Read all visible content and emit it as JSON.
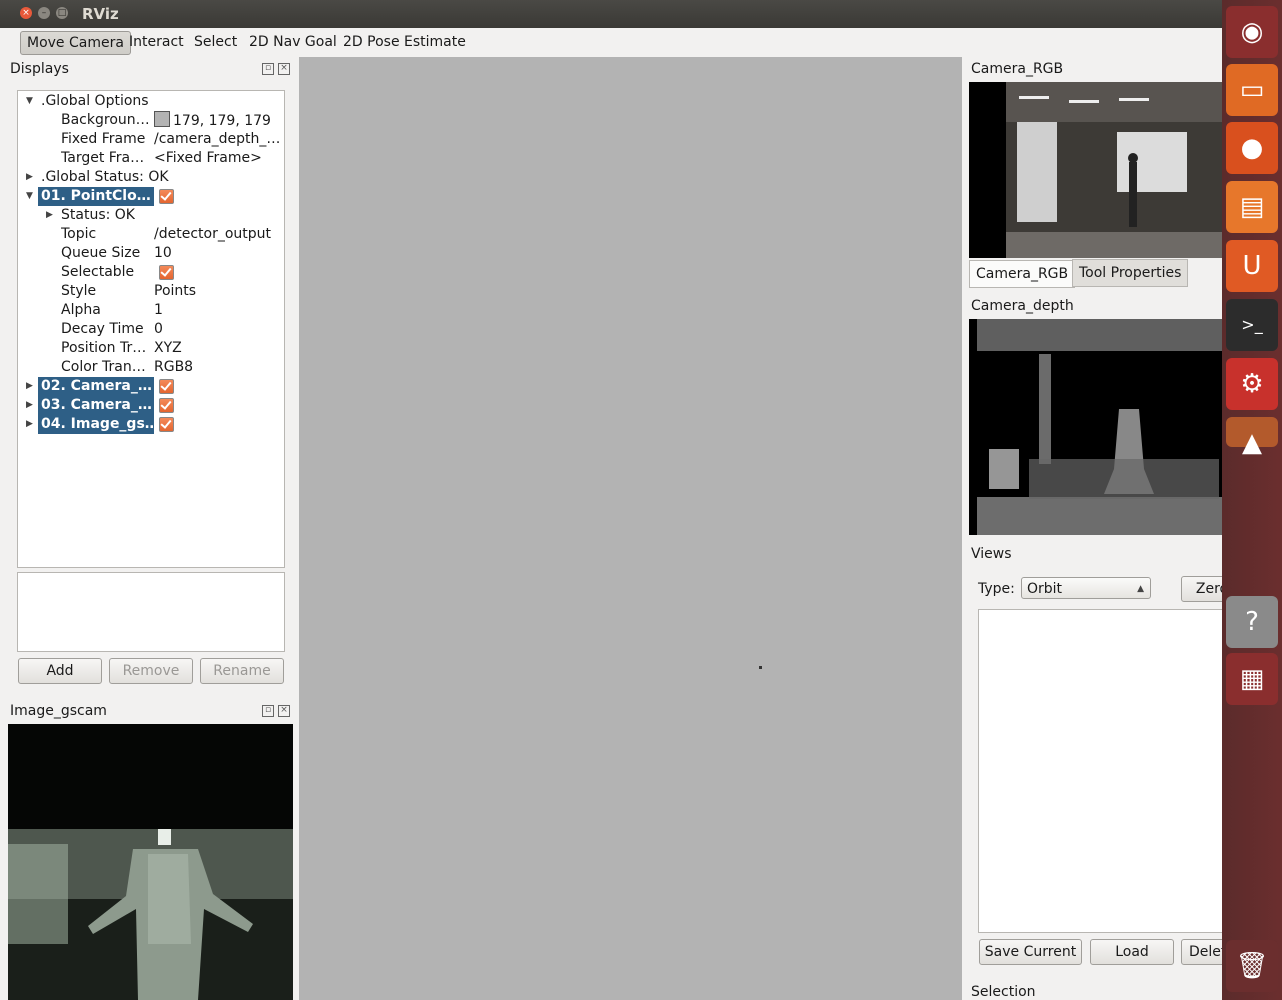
{
  "window": {
    "title": "RViz"
  },
  "toolbar": {
    "tools": [
      "Move Camera",
      "Interact",
      "Select",
      "2D Nav Goal",
      "2D Pose Estimate"
    ]
  },
  "displays": {
    "title": "Displays",
    "rows": [
      {
        "key": ".Global Options",
        "value": ""
      },
      {
        "key": "Backgroun…",
        "value": "179, 179, 179"
      },
      {
        "key": "Fixed Frame",
        "value": "/camera_depth_…"
      },
      {
        "key": "Target Fra…",
        "value": "<Fixed Frame>"
      },
      {
        "key": ".Global Status: OK",
        "value": ""
      },
      {
        "key": "01. PointClo…",
        "value": ""
      },
      {
        "key": "Status: OK",
        "value": ""
      },
      {
        "key": "Topic",
        "value": "/detector_output"
      },
      {
        "key": "Queue Size",
        "value": "10"
      },
      {
        "key": "Selectable",
        "value": ""
      },
      {
        "key": "Style",
        "value": "Points"
      },
      {
        "key": "Alpha",
        "value": "1"
      },
      {
        "key": "Decay Time",
        "value": "0"
      },
      {
        "key": "Position Tr…",
        "value": "XYZ"
      },
      {
        "key": "Color Tran…",
        "value": "RGB8"
      },
      {
        "key": "02. Camera_…",
        "value": ""
      },
      {
        "key": "03. Camera_…",
        "value": ""
      },
      {
        "key": "04. Image_gs…",
        "value": ""
      }
    ],
    "buttons": {
      "add": "Add",
      "remove": "Remove",
      "rename": "Rename"
    }
  },
  "image_gscam": {
    "title": "Image_gscam"
  },
  "camera_rgb": {
    "title": "Camera_RGB",
    "tabs": [
      "Camera_RGB",
      "Tool Properties"
    ]
  },
  "camera_depth": {
    "title": "Camera_depth"
  },
  "views": {
    "title": "Views",
    "type_label": "Type:",
    "type_value": "Orbit",
    "zero_label": "Zero",
    "buttons": {
      "save": "Save Current",
      "load": "Load",
      "delete": "Delete"
    }
  },
  "selection": {
    "title": "Selection"
  },
  "colors": {
    "viewport": "#b3b3b3",
    "selected_row": "#2e5f86",
    "checkbox": "#e4652f",
    "launcher": "#6b2e2e"
  }
}
